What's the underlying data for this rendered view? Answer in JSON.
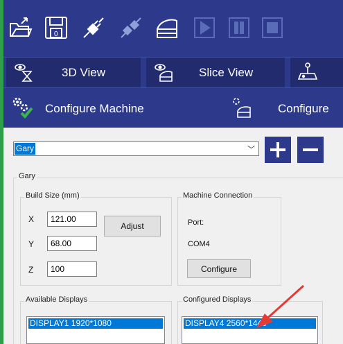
{
  "toolbar": {
    "icons": [
      "open-folder-icon",
      "save-icon",
      "connect-icon",
      "disconnect-icon",
      "slice-icon",
      "play-icon",
      "pause-icon",
      "stop-icon"
    ]
  },
  "view_tabs": [
    {
      "label": "3D View",
      "icon": "eye-hourglass-icon"
    },
    {
      "label": "Slice View",
      "icon": "eye-layers-icon"
    },
    {
      "label": "",
      "icon": "joystick-icon"
    }
  ],
  "config_tabs": [
    {
      "label": "Configure Machine",
      "icon": "gears-check-icon"
    },
    {
      "label": "Configure",
      "icon": "gear-layers-icon"
    }
  ],
  "machine_select": {
    "value": "Gary"
  },
  "add_label": "+",
  "remove_label": "−",
  "machine_group": {
    "title": "Gary"
  },
  "build_size": {
    "title": "Build Size (mm)",
    "x_label": "X",
    "x_value": "121.00",
    "y_label": "Y",
    "y_value": "68.00",
    "z_label": "Z",
    "z_value": "100",
    "adjust_label": "Adjust"
  },
  "connection": {
    "title": "Machine Connection",
    "port_label": "Port:",
    "port_value": "COM4",
    "configure_label": "Configure"
  },
  "available_displays": {
    "title": "Available Displays",
    "items": [
      "DISPLAY1 1920*1080"
    ]
  },
  "configured_displays": {
    "title": "Configured Displays",
    "items": [
      "DISPLAY4 2560*1440"
    ]
  },
  "colors": {
    "toolbar_bg": "#2d3a8c",
    "tab_bg": "#222b6e",
    "selection": "#0078d7",
    "annotation_arrow": "#e53935"
  }
}
